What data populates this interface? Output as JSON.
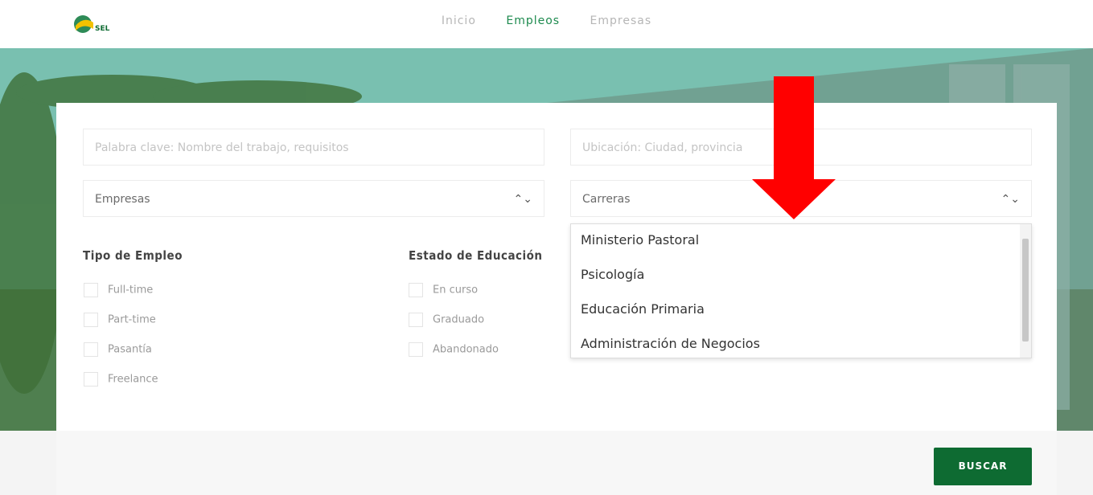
{
  "nav": {
    "items": [
      "Inicio",
      "Empleos",
      "Empresas"
    ],
    "active": "Empleos"
  },
  "brand": {
    "logo_text": "SEL",
    "accent": "#0e6b32"
  },
  "search": {
    "keyword_placeholder": "Palabra clave: Nombre del trabajo, requisitos",
    "location_placeholder": "Ubicación: Ciudad, provincia",
    "company_select": "Empresas",
    "career_select": "Carreras",
    "career_options": [
      "Ministerio Pastoral",
      "Psicología",
      "Educación Primaria",
      "Administración de Negocios"
    ]
  },
  "filters": {
    "tipo_title": "Tipo de Empleo",
    "tipo_options": [
      "Full-time",
      "Part-time",
      "Pasantía",
      "Freelance"
    ],
    "estado_title": "Estado de Educación",
    "estado_options": [
      "En curso",
      "Graduado",
      "Abandonado"
    ]
  },
  "button": {
    "label": "BUSCAR"
  },
  "annotation": {
    "arrow_color": "#ff0000"
  }
}
